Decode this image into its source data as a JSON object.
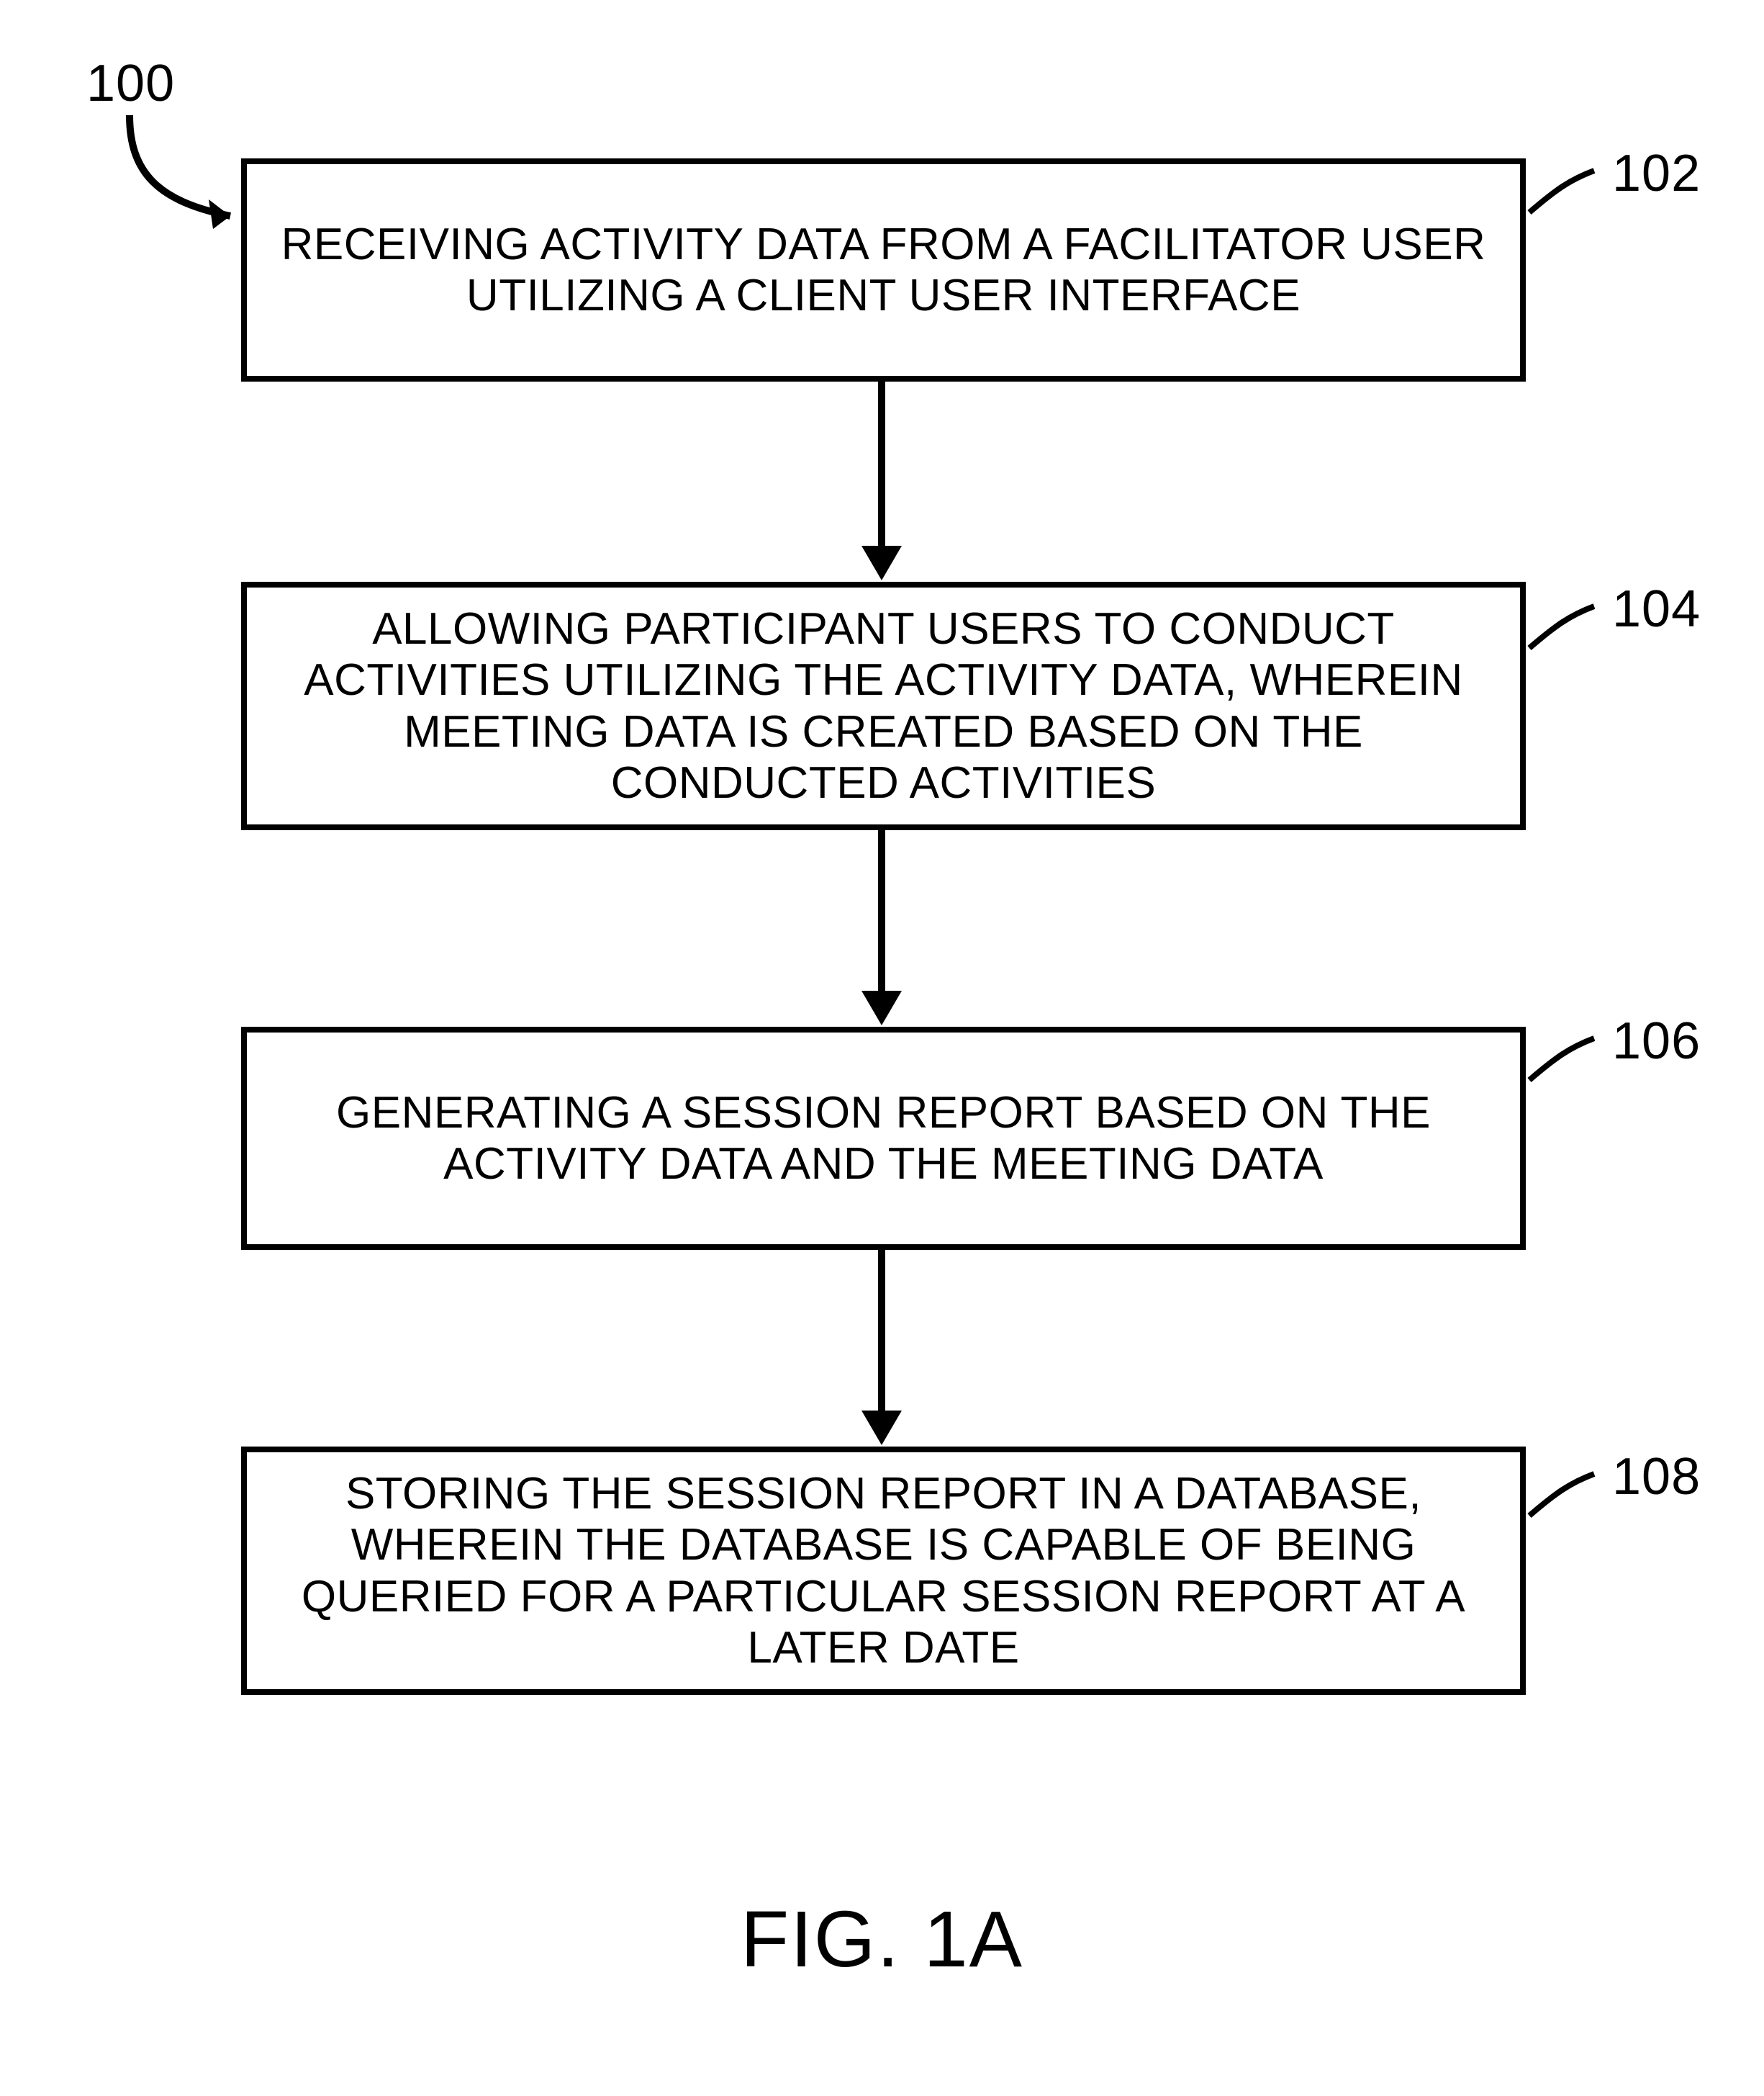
{
  "figure": {
    "caption": "FIG. 1A",
    "overall_ref": "100",
    "steps": [
      {
        "ref": "102",
        "text": "RECEIVING ACTIVITY DATA FROM A FACILITATOR USER UTILIZING A CLIENT USER INTERFACE"
      },
      {
        "ref": "104",
        "text": "ALLOWING PARTICIPANT USERS TO CONDUCT ACTIVITIES UTILIZING THE ACTIVITY DATA, WHEREIN MEETING DATA IS CREATED BASED ON THE CONDUCTED ACTIVITIES"
      },
      {
        "ref": "106",
        "text": "GENERATING A SESSION REPORT BASED ON THE ACTIVITY DATA AND THE MEETING DATA"
      },
      {
        "ref": "108",
        "text": "STORING THE SESSION REPORT IN A DATABASE, WHEREIN THE DATABASE IS CAPABLE OF BEING QUERIED FOR A PARTICULAR SESSION REPORT AT A LATER DATE"
      }
    ]
  }
}
